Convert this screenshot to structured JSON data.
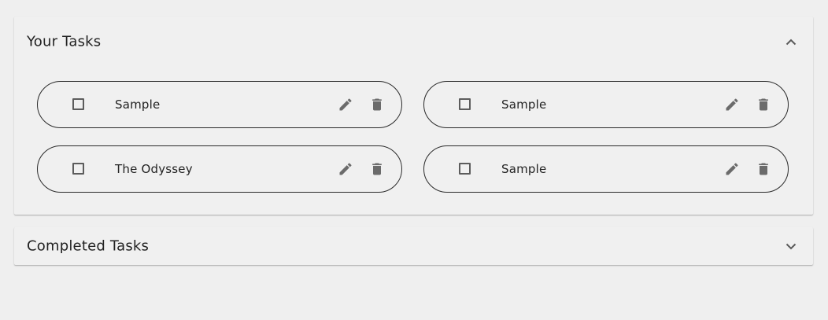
{
  "tasks_panel": {
    "title": "Your Tasks",
    "expanded": true,
    "toggle_icon": "chevron-up-icon",
    "tasks": [
      {
        "label": "Sample",
        "checked": false
      },
      {
        "label": "Sample",
        "checked": false
      },
      {
        "label": "The Odyssey",
        "checked": false
      },
      {
        "label": "Sample",
        "checked": false
      }
    ],
    "task_icons": [
      "edit-icon",
      "delete-icon"
    ]
  },
  "completed_panel": {
    "title": "Completed Tasks",
    "expanded": false,
    "toggle_icon": "chevron-down-icon"
  },
  "colors": {
    "background": "#efefef",
    "panel": "#f0f0f0",
    "icon": "#6b6b6b",
    "border": "#2b2b2b"
  }
}
